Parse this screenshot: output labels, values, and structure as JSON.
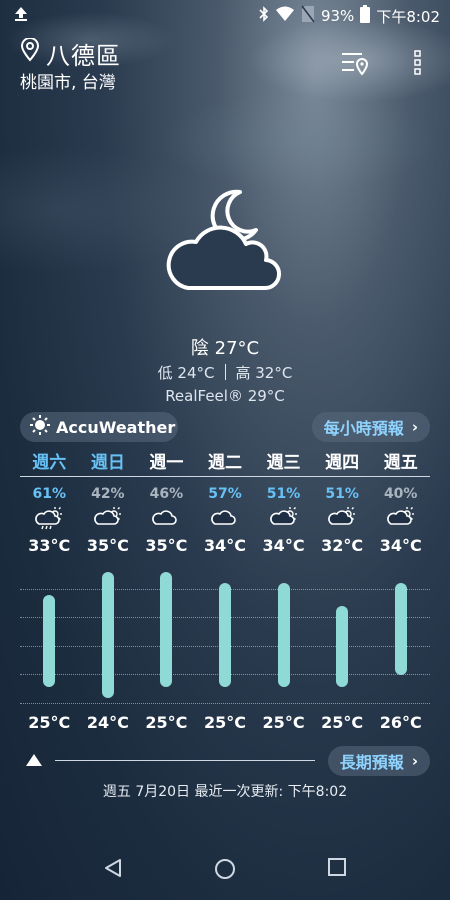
{
  "status_bar": {
    "upload_icon": "upload-arrow-icon",
    "battery": "93%",
    "time": "下午8:02",
    "icons": [
      "bluetooth-icon",
      "wifi-icon",
      "no-sim-icon",
      "battery-icon"
    ]
  },
  "header": {
    "location_name": "八德區",
    "location_sub": "桃園市, 台灣",
    "pin_icon": "location-pin-icon",
    "locations_button_icon": "location-list-icon",
    "menu_button_icon": "more-vert-icon"
  },
  "current": {
    "icon": "cloudy-night-moon-icon",
    "condition": "陰 27°C",
    "low": "低 24°C",
    "high": "高 32°C",
    "realfeel": "RealFeel® 29°C"
  },
  "brand": {
    "name": "AccuWeather",
    "icon": "sun-logo-icon"
  },
  "hourly_link": "每小時預報",
  "days": [
    {
      "name": "週六",
      "active": true,
      "precip": "61%",
      "precip_active": true,
      "hi": "33°C",
      "lo": "25°C",
      "icon": "cloud-rain-icon"
    },
    {
      "name": "週日",
      "active": true,
      "precip": "42%",
      "precip_active": false,
      "hi": "35°C",
      "lo": "24°C",
      "icon": "partly-cloudy-icon"
    },
    {
      "name": "週一",
      "active": false,
      "precip": "46%",
      "precip_active": false,
      "hi": "35°C",
      "lo": "25°C",
      "icon": "cloudy-icon"
    },
    {
      "name": "週二",
      "active": false,
      "precip": "57%",
      "precip_active": true,
      "hi": "34°C",
      "lo": "25°C",
      "icon": "cloudy-icon"
    },
    {
      "name": "週三",
      "active": false,
      "precip": "51%",
      "precip_active": true,
      "hi": "34°C",
      "lo": "25°C",
      "icon": "partly-cloudy-icon"
    },
    {
      "name": "週四",
      "active": false,
      "precip": "51%",
      "precip_active": true,
      "hi": "32°C",
      "lo": "25°C",
      "icon": "partly-cloudy-icon"
    },
    {
      "name": "週五",
      "active": false,
      "precip": "40%",
      "precip_active": false,
      "hi": "34°C",
      "lo": "26°C",
      "icon": "partly-cloudy-icon"
    }
  ],
  "chart_data": {
    "type": "bar",
    "categories": [
      "週六",
      "週日",
      "週一",
      "週二",
      "週三",
      "週四",
      "週五"
    ],
    "series": [
      {
        "values_low": [
          25,
          24,
          25,
          25,
          25,
          25,
          26
        ],
        "values_high": [
          33,
          35,
          35,
          34,
          34,
          32,
          34
        ]
      }
    ],
    "ylim": [
      23,
      36
    ]
  },
  "long_term_link": "長期預報",
  "updated": "週五 7月20日 最近一次更新: 下午8:02",
  "colors": {
    "accent": "#67c1f5",
    "bar": "#8fdad6",
    "pill_text": "#8fd4ff"
  },
  "nav": {
    "back_icon": "back-triangle-icon",
    "home_icon": "home-circle-icon",
    "recents_icon": "recents-square-icon"
  }
}
